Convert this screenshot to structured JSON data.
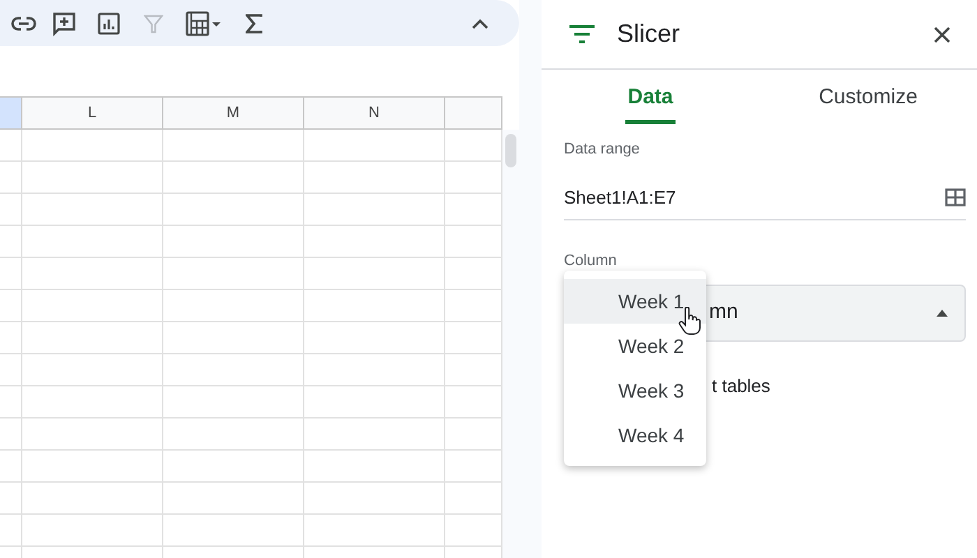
{
  "toolbar": {
    "buttons": [
      {
        "kind": "link",
        "disabled": false
      },
      {
        "kind": "comment",
        "disabled": false
      },
      {
        "kind": "chart",
        "disabled": false
      },
      {
        "kind": "filter",
        "disabled": true
      },
      {
        "kind": "table",
        "disabled": false
      },
      {
        "kind": "sigma",
        "disabled": false
      }
    ],
    "collapse": {
      "kind": "chevron"
    }
  },
  "sheet": {
    "columns": [
      {
        "selected": true
      },
      {
        "label": "L",
        "selected": false
      },
      {
        "label": "M",
        "selected": false
      },
      {
        "label": "N",
        "selected": false
      },
      {
        "selected": false
      }
    ]
  },
  "panel": {
    "title": "Slicer",
    "tabs": [
      {
        "label": "Data",
        "selected": true
      },
      {
        "label": "Customize",
        "selected": false
      }
    ],
    "data_range": {
      "label": "Data range",
      "value": "Sheet1!A1:E7"
    },
    "column": {
      "label": "Column",
      "value": "mn",
      "expanded": true,
      "options": [
        {
          "label": "Week 1",
          "hovered": true
        },
        {
          "label": "Week 2",
          "hovered": false
        },
        {
          "label": "Week 3",
          "hovered": false
        },
        {
          "label": "Week 4",
          "hovered": false
        }
      ]
    },
    "pivot_option": {
      "label": "t tables"
    }
  }
}
